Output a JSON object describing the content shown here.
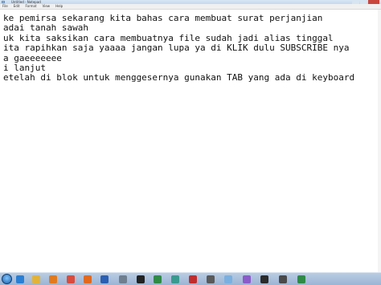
{
  "window": {
    "title": "Untitled - Notepad"
  },
  "menu": [
    "File",
    "Edit",
    "Format",
    "View",
    "Help"
  ],
  "document": {
    "lines": [
      "ke pemirsa sekarang kita bahas cara membuat surat perjanjian",
      "adai tanah sawah",
      "uk kita saksikan cara membuatnya file sudah jadi alias tinggal",
      "ita rapihkan saja yaaaa jangan lupa ya di KLIK dulu SUBSCRIBE nya",
      "a gaeeeeeee",
      "i lanjut",
      "etelah di blok untuk menggesernya gunakan TAB yang ada di keyboard"
    ]
  },
  "taskbar": {
    "icons": [
      "start-orb",
      "ie-icon",
      "folder-icon",
      "media-icon",
      "chrome-icon",
      "firefox-icon",
      "word-icon",
      "wrench-icon",
      "cmd-icon",
      "excel-icon",
      "app-icon",
      "app2-icon",
      "app3-icon",
      "notepad-icon",
      "paint-icon",
      "app4-icon",
      "app5-icon",
      "app6-icon"
    ],
    "colors": {
      "ie-icon": "#2a7fd4",
      "folder-icon": "#e2b33a",
      "media-icon": "#e07a1f",
      "chrome-icon": "#d94c3d",
      "firefox-icon": "#e06a20",
      "word-icon": "#2b5fb2",
      "wrench-icon": "#6f7f90",
      "cmd-icon": "#222222",
      "excel-icon": "#2f8a46",
      "app-icon": "#3a9a8f",
      "app2-icon": "#c02d2d",
      "app3-icon": "#5a5a5a",
      "notepad-icon": "#7ab0e0",
      "paint-icon": "#8a5cc9",
      "app4-icon": "#2b2b2b",
      "app5-icon": "#4a4a4a",
      "app6-icon": "#2f8a46"
    }
  }
}
